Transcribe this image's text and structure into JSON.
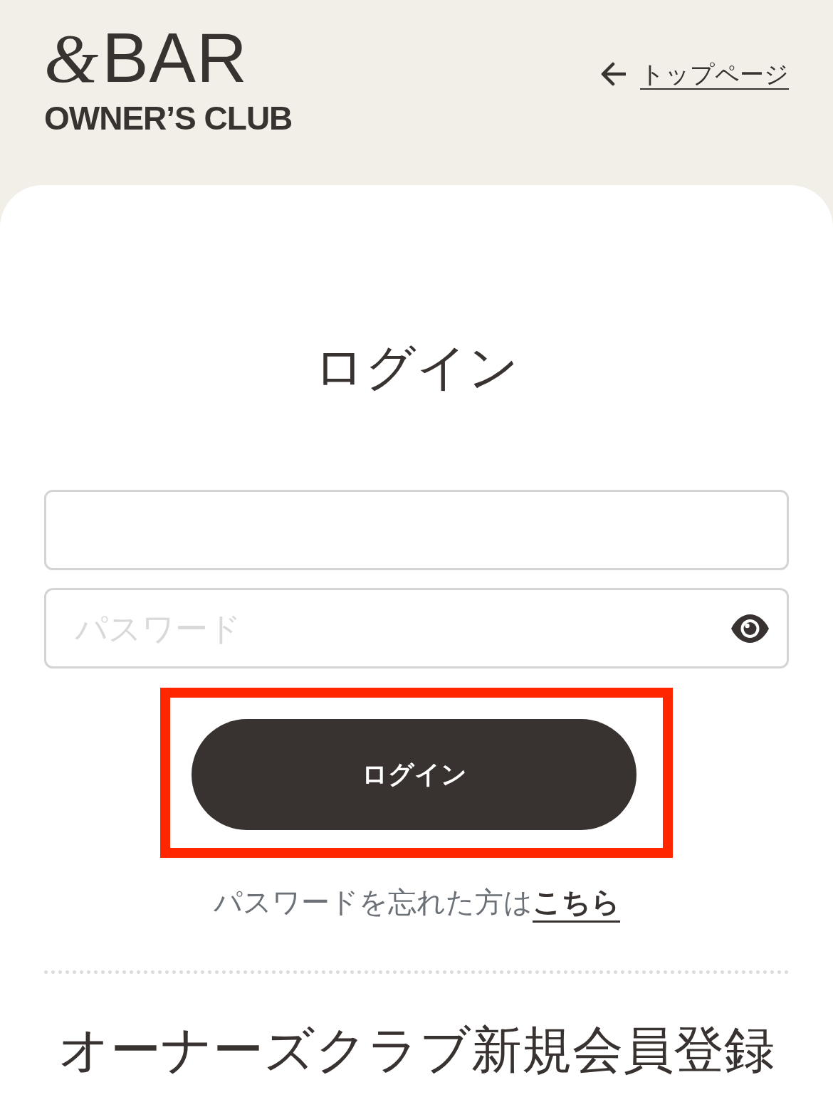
{
  "header": {
    "logo": "&BAR",
    "subtitle": "OWNER’S CLUB",
    "back_link": {
      "label": "トップページ"
    }
  },
  "login": {
    "title": "ログイン",
    "fields": [
      {
        "kind": "text"
      },
      {
        "kind": "password",
        "placeholder": "パスワード"
      }
    ],
    "submit": {
      "label": "ログイン",
      "highlighted": true
    },
    "forgot": {
      "text": "パスワードを忘れた方は",
      "link": "こちら"
    }
  },
  "register": {
    "title": "オーナーズクラブ新規会員登録"
  }
}
